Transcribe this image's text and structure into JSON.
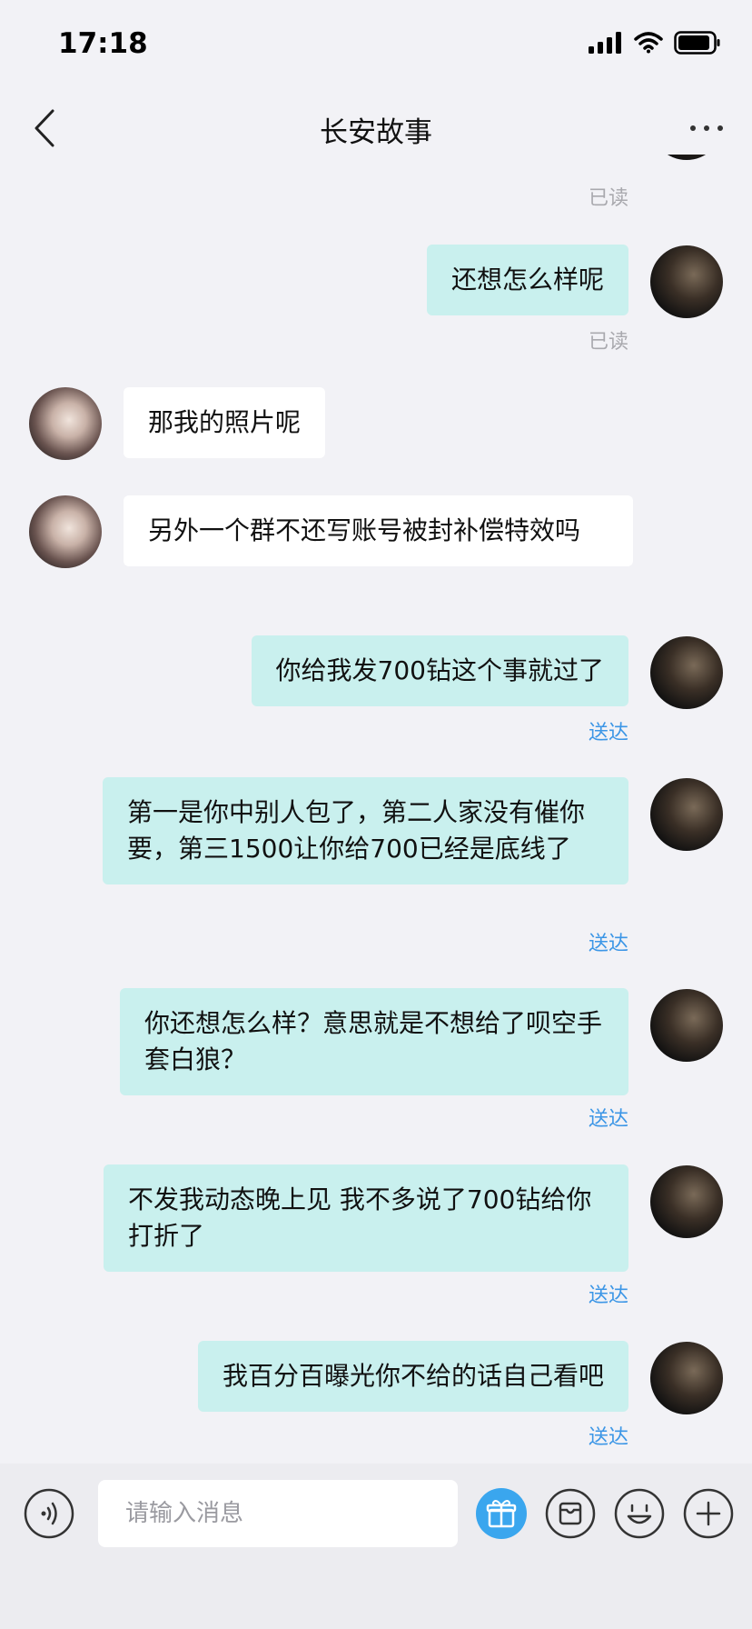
{
  "status": {
    "time": "17:18"
  },
  "nav": {
    "title": "长安故事"
  },
  "receipts": {
    "read": "已读",
    "sent": "送达"
  },
  "messages": [
    {
      "text": "还想怎么样呢"
    },
    {
      "text": "那我的照片呢"
    },
    {
      "text": "另外一个群不还写账号被封补偿特效吗"
    },
    {
      "text": "你给我发700钻这个事就过了"
    },
    {
      "text": "第一是你中别人包了，第二人家没有催你要，第三1500让你给700已经是底线了"
    },
    {
      "text": "你还想怎么样？意思就是不想给了呗空手套白狼？"
    },
    {
      "text": "不发我动态晚上见 我不多说了700钻给你打折了"
    },
    {
      "text": "我百分百曝光你不给的话自己看吧"
    }
  ],
  "input": {
    "placeholder": "请输入消息"
  },
  "icons": {
    "voice": "voice-icon",
    "gift": "gift-icon",
    "inbox": "inbox-icon",
    "emoji": "emoji-icon",
    "add": "add-icon"
  },
  "colors": {
    "outgoing_bubble": "#c9f0ee",
    "incoming_bubble": "#ffffff",
    "sent_receipt": "#3c96e6",
    "gift_accent": "#3aa6ee"
  }
}
